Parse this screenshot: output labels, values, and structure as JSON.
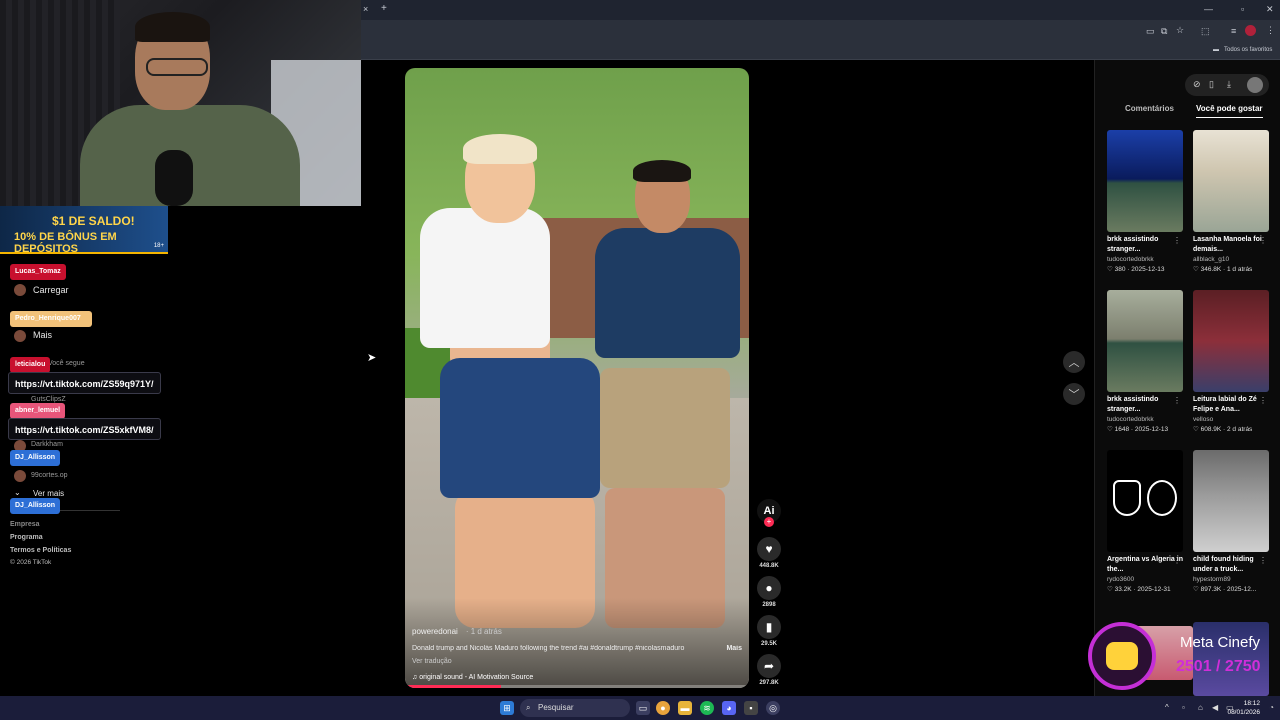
{
  "browser": {
    "close_tab": "×",
    "new_tab": "+",
    "bookmarks_label": "Todos os favoritos"
  },
  "promo": {
    "line1": "$1 DE SALDO!",
    "line2": "10% DE BÔNUS EM DEPÓSITOS",
    "age": "18+"
  },
  "sidebar": {
    "carregar": "Carregar",
    "mais": "Mais",
    "voce_segue": "Você segue",
    "user_1": "GutsClipsZ",
    "user_2": "Darkkham",
    "user_3": "99cortes.op",
    "ver_mais": "Ver mais",
    "footer_1": "Empresa",
    "footer_2": "Programa",
    "footer_3": "Termos e Políticas",
    "copyright": "© 2026 TikTok"
  },
  "chat": {
    "n1": "Lucas_Tomaz",
    "n2": "Pedro_Henrique007",
    "n3": "leticialou",
    "m3": "https://vt.tiktok.com/ZS59q971Y/",
    "n4": "abner_lemuel",
    "m4": "https://vt.tiktok.com/ZS5xkfVM8/",
    "n5": "DJ_Allisson",
    "n6": "DJ_Allisson"
  },
  "video": {
    "username": "poweredonai",
    "date": "· 1 d atrás",
    "description": "Donald trump and Nicolás Maduro following the trend #ai #donaldtrump #nicolasmaduro",
    "more": "Mais",
    "translate": "Ver tradução",
    "sound": "original sound - AI Motivation Source",
    "progress": 0.28
  },
  "rail": {
    "likes": "448.8K",
    "comments": "2898",
    "saves": "29.5K",
    "shares": "297.8K"
  },
  "panel": {
    "tab_comments": "Comentários",
    "tab_like": "Você pode gostar",
    "cards": [
      {
        "title": "brkk assistindo stranger...",
        "author": "tudocortedobrkk",
        "stats": "♡ 380 · 2025-12-13"
      },
      {
        "title": "Lasanha Manoela foi demais...",
        "author": "allblack_g10",
        "stats": "♡ 346.8K · 1 d atrás"
      },
      {
        "title": "brkk assistindo stranger...",
        "author": "tudocortedobrkk",
        "stats": "♡ 1648 · 2025-12-13"
      },
      {
        "title": "Leitura labial do Zé Felipe e Ana...",
        "author": "velloso",
        "stats": "♡ 608.9K · 2 d atrás"
      },
      {
        "title": "Argentina vs Algeria in the...",
        "author": "rydo3600",
        "stats": "♡ 33.2K · 2025-12-31"
      },
      {
        "title": "child found hiding under a truck...",
        "author": "hypestorm89",
        "stats": "♡ 897.3K · 2025-12..."
      }
    ]
  },
  "overlay": {
    "title": "Meta Cinefy",
    "count": "2501 / 2750"
  },
  "taskbar": {
    "search": "Pesquisar",
    "time": "18:12",
    "date": "08/01/2026"
  }
}
